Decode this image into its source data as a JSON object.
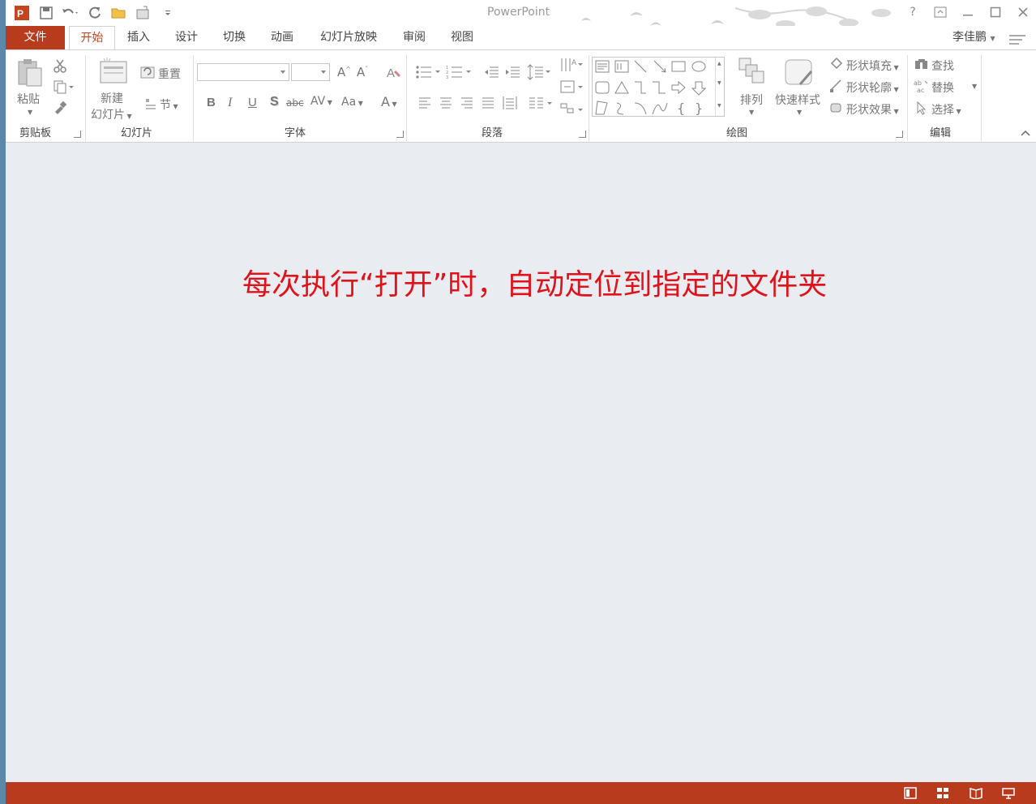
{
  "app": {
    "title": "PowerPoint",
    "user": "李佳鹏",
    "qat_icons": [
      "powerpoint-logo-icon",
      "save-icon",
      "undo-icon",
      "redo-icon",
      "open-icon",
      "new-icon",
      "customize-icon"
    ],
    "accent": "#b83b1e"
  },
  "tabs": [
    {
      "label": "文件"
    },
    {
      "label": "开始"
    },
    {
      "label": "插入"
    },
    {
      "label": "设计"
    },
    {
      "label": "切换"
    },
    {
      "label": "动画"
    },
    {
      "label": "幻灯片放映"
    },
    {
      "label": "审阅"
    },
    {
      "label": "视图"
    }
  ],
  "ribbon": {
    "clipboard": {
      "label": "剪贴板",
      "paste": "粘贴"
    },
    "slides": {
      "label": "幻灯片",
      "new_slide_1": "新建",
      "new_slide_2": "幻灯片",
      "reset": "重置",
      "section": "节"
    },
    "font": {
      "label": "字体",
      "bold": "B",
      "italic": "I",
      "underline": "U",
      "shadow": "S",
      "strike": "abc",
      "spacing": "AV",
      "case": "Aa",
      "color": "A"
    },
    "paragraph": {
      "label": "段落"
    },
    "drawing": {
      "label": "绘图",
      "arrange": "排列",
      "quick_styles": "快速样式",
      "fill": "形状填充",
      "outline": "形状轮廓",
      "effects": "形状效果"
    },
    "editing": {
      "label": "编辑",
      "find": "查找",
      "replace": "替换",
      "select": "选择"
    }
  },
  "message": "每次执行“打开”时，自动定位到指定的文件夹",
  "status_icons": [
    "normal-view-icon",
    "slide-sorter-icon",
    "reading-view-icon",
    "slideshow-icon"
  ]
}
